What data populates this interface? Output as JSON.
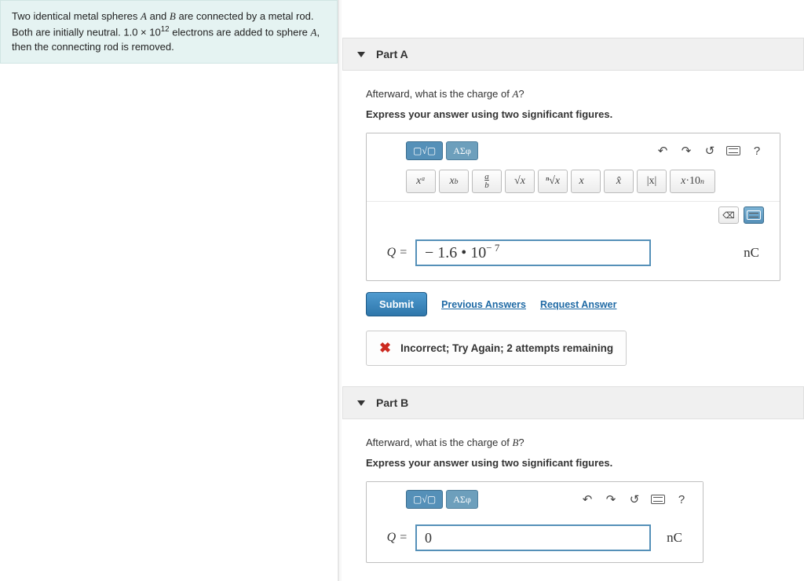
{
  "problem": {
    "line1_pre": "Two identical metal spheres ",
    "A": "A",
    "line1_mid": " and ",
    "B": "B",
    "line1_post": " are connected by a metal rod. Both are initially neutral. ",
    "value": "1.0 × 10",
    "exp": "12",
    "line2": " electrons are added to sphere ",
    "line3": ", then the connecting rod is removed."
  },
  "partA": {
    "header": "Part A",
    "prompt_pre": "Afterward, what is the charge of ",
    "prompt_var": "A",
    "prompt_post": "?",
    "instr": "Express your answer using two significant figures.",
    "toolbar": {
      "tmpl": "▢√▢",
      "greek": "ΑΣφ",
      "undo": "↶",
      "redo": "↷",
      "reset": "↺",
      "help": "?"
    },
    "math_btns": {
      "pow": "xᵃ",
      "sub": "x_b",
      "frac": "a⁄b",
      "sqrt": "√x",
      "nroot": "ⁿ√x",
      "vec": "x⃗",
      "hat": "x̂",
      "abs": "|x|",
      "sci": "x·10ⁿ"
    },
    "answer_label": "Q =",
    "answer_value_main": "− 1.6 • 10",
    "answer_value_exp": "− 7",
    "unit": "nC",
    "submit": "Submit",
    "prev": "Previous Answers",
    "req": "Request Answer",
    "feedback": "Incorrect; Try Again; 2 attempts remaining"
  },
  "partB": {
    "header": "Part B",
    "prompt_pre": "Afterward, what is the charge of ",
    "prompt_var": "B",
    "prompt_post": "?",
    "instr": "Express your answer using two significant figures.",
    "toolbar": {
      "tmpl": "▢√▢",
      "greek": "ΑΣφ",
      "undo": "↶",
      "redo": "↷",
      "reset": "↺",
      "help": "?"
    },
    "answer_label": "Q =",
    "answer_value": "0",
    "unit": "nC"
  }
}
